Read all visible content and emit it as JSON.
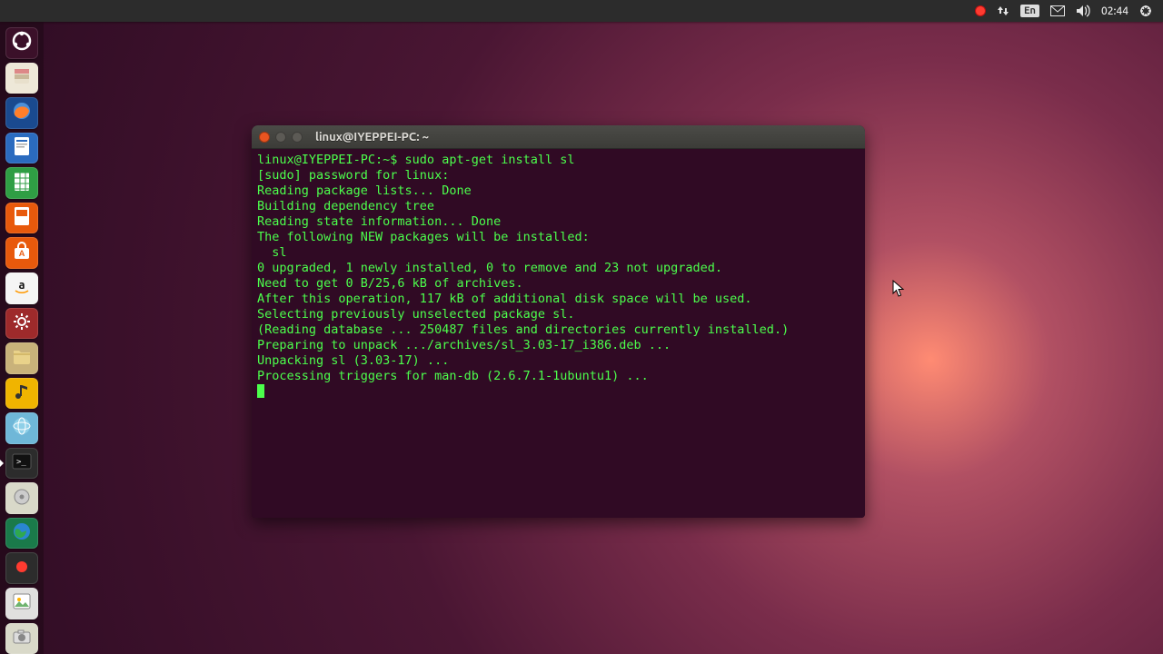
{
  "panel": {
    "lang": "En",
    "time": "02:44"
  },
  "launcher": {
    "items": [
      {
        "name": "dash",
        "bg": "#3b1029",
        "icon": "ubuntu"
      },
      {
        "name": "files",
        "bg": "#eee8d8",
        "icon": "drawer"
      },
      {
        "name": "firefox",
        "bg": "#1a4a8f",
        "icon": "firefox"
      },
      {
        "name": "writer",
        "bg": "#2b6bbf",
        "icon": "doc"
      },
      {
        "name": "calc",
        "bg": "#2f9e44",
        "icon": "sheet"
      },
      {
        "name": "impress",
        "bg": "#e8590c",
        "icon": "slides"
      },
      {
        "name": "software",
        "bg": "#e8590c",
        "icon": "bag"
      },
      {
        "name": "amazon",
        "bg": "#f5f5f5",
        "icon": "amazon"
      },
      {
        "name": "settings",
        "bg": "#9e2a2b",
        "icon": "gear"
      },
      {
        "name": "folder",
        "bg": "#c9b27a",
        "icon": "folder"
      },
      {
        "name": "rhythmbox",
        "bg": "#f0b400",
        "icon": "music"
      },
      {
        "name": "browser",
        "bg": "#6fb7d8",
        "icon": "globe"
      },
      {
        "name": "terminal",
        "bg": "#2c2c2c",
        "icon": "terminal",
        "active": true
      },
      {
        "name": "disk",
        "bg": "#d9d9c9",
        "icon": "disk"
      },
      {
        "name": "earth",
        "bg": "#1a7a4a",
        "icon": "earth"
      },
      {
        "name": "kazam",
        "bg": "#2c2c2c",
        "icon": "rec"
      },
      {
        "name": "screenshot",
        "bg": "#e0e0de",
        "icon": "picture"
      },
      {
        "name": "cheese",
        "bg": "#d9d9c9",
        "icon": "camera"
      }
    ]
  },
  "terminal": {
    "title": "linux@IYEPPEI-PC: ~",
    "prompt": "linux@IYEPPEI-PC:~$ ",
    "command": "sudo apt-get install sl",
    "output": [
      "[sudo] password for linux: ",
      "Reading package lists... Done",
      "Building dependency tree       ",
      "Reading state information... Done",
      "The following NEW packages will be installed:",
      "  sl",
      "0 upgraded, 1 newly installed, 0 to remove and 23 not upgraded.",
      "Need to get 0 B/25,6 kB of archives.",
      "After this operation, 117 kB of additional disk space will be used.",
      "Selecting previously unselected package sl.",
      "(Reading database ... 250487 files and directories currently installed.)",
      "Preparing to unpack .../archives/sl_3.03-17_i386.deb ...",
      "Unpacking sl (3.03-17) ...",
      "Processing triggers for man-db (2.6.7.1-1ubuntu1) ..."
    ]
  }
}
